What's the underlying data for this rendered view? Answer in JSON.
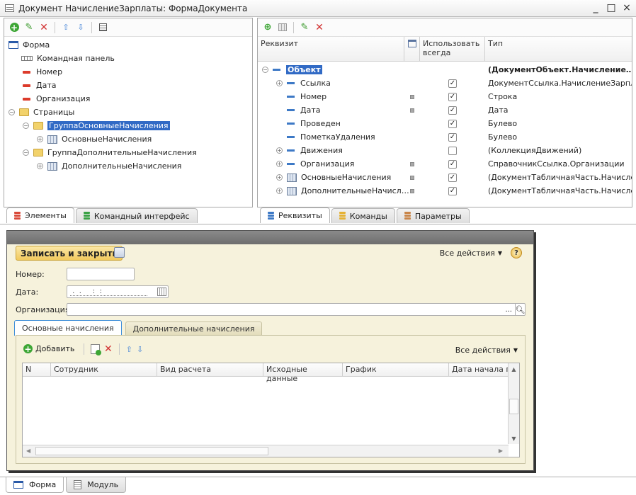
{
  "window": {
    "title": "Документ НачислениеЗарплаты: ФормаДокумента",
    "minimize": "_",
    "maximize": "□",
    "close": "×"
  },
  "left_tree": [
    {
      "label": "Форма",
      "icon": "form-icon",
      "indent": 0
    },
    {
      "label": "Командная панель",
      "icon": "command-panel-icon",
      "indent": 1
    },
    {
      "label": "Номер",
      "icon": "field-icon",
      "indent": 1
    },
    {
      "label": "Дата",
      "icon": "field-icon",
      "indent": 1
    },
    {
      "label": "Организация",
      "icon": "field-icon",
      "indent": 1
    },
    {
      "label": "Страницы",
      "icon": "folder-icon",
      "indent": 0
    },
    {
      "label": "ГруппаОсновныеНачисления",
      "icon": "folder-icon",
      "indent": 1
    },
    {
      "label": "ОсновныеНачисления",
      "icon": "table-icon",
      "indent": 2
    },
    {
      "label": "ГруппаДополнительныеНачисления",
      "icon": "folder-icon",
      "indent": 1
    },
    {
      "label": "ДополнительныеНачисления",
      "icon": "table-icon",
      "indent": 2
    }
  ],
  "left_tabs": {
    "elements": "Элементы",
    "command_interface": "Командный интерфейс"
  },
  "right_header": {
    "rekvizit": "Реквизит",
    "use_always": "Использовать всегда",
    "type": "Тип"
  },
  "right_rows": [
    {
      "name": "Объект",
      "type": "(ДокументОбъект.Начисление…",
      "checked": false
    },
    {
      "name": "Ссылка",
      "type": "ДокументСсылка.НачислениеЗарпл…",
      "checked": true
    },
    {
      "name": "Номер",
      "type": "Строка",
      "checked": true
    },
    {
      "name": "Дата",
      "type": "Дата",
      "checked": true
    },
    {
      "name": "Проведен",
      "type": "Булево",
      "checked": true
    },
    {
      "name": "ПометкаУдаления",
      "type": "Булево",
      "checked": true
    },
    {
      "name": "Движения",
      "type": "(КоллекцияДвижений)",
      "checked": false
    },
    {
      "name": "Организация",
      "type": "СправочникСсылка.Организации",
      "checked": true
    },
    {
      "name": "ОсновныеНачисления",
      "type": "(ДокументТабличнаяЧасть.Начисле…",
      "checked": true
    },
    {
      "name": "ДополнительныеНачисл…",
      "type": "(ДокументТабличнаяЧасть.Начисле…",
      "checked": true
    }
  ],
  "right_tabs": {
    "rekvizity": "Реквизиты",
    "commands": "Команды",
    "parameters": "Параметры"
  },
  "form": {
    "write_close": "Записать и закрыть",
    "all_actions": "Все действия",
    "help": "?",
    "number_label": "Номер:",
    "date_label": "Дата:",
    "date_value": " .  .     :  :",
    "org_label": "Организация:",
    "org_ellipsis": "...",
    "tab_main": "Основные начисления",
    "tab_additional": "Дополнительные начисления",
    "add": "Добавить",
    "all_actions_table": "Все действия",
    "columns": [
      "N",
      "Сотрудник",
      "Вид расчета",
      "Исходные данные",
      "График",
      "Дата начала пер"
    ]
  },
  "bottom_tabs": {
    "form": "Форма",
    "module": "Модуль"
  }
}
